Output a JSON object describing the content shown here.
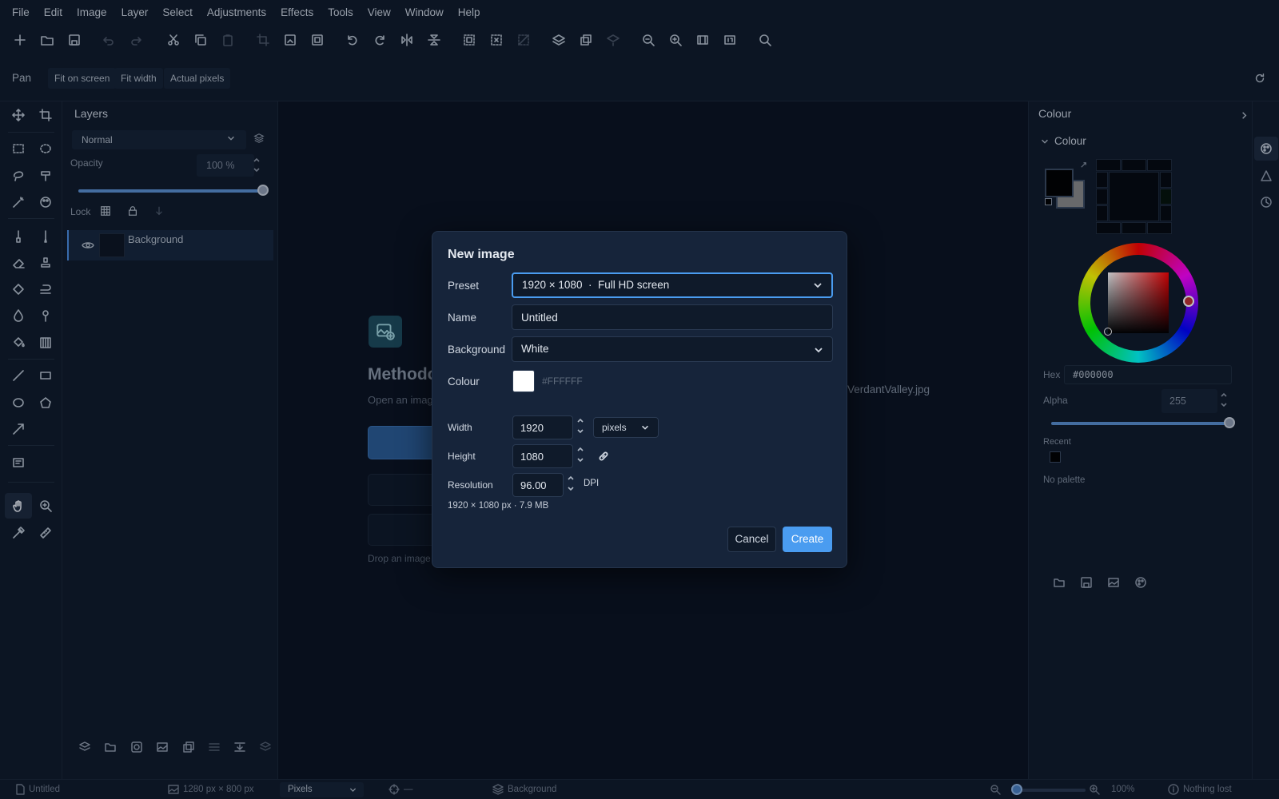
{
  "menu": [
    "File",
    "Edit",
    "Image",
    "Layer",
    "Select",
    "Adjustments",
    "Effects",
    "Tools",
    "View",
    "Window",
    "Help"
  ],
  "options_bar": {
    "tool_name": "Pan",
    "fit_on_screen": "Fit on screen",
    "fit_width": "Fit width",
    "actual_pixels": "Actual pixels"
  },
  "layers": {
    "title": "Layers",
    "blend_mode": "Normal",
    "opacity_label": "Opacity",
    "opacity_value": "100 %",
    "opacity_level": 1.0,
    "lock_label": "Lock",
    "items": [
      {
        "name": "Background"
      }
    ]
  },
  "welcome": {
    "title": "Methodo",
    "subtitle": "Open an imag",
    "drop_hint": "Drop an image a",
    "recent_file": "VerdantValley.jpg"
  },
  "colour_panel": {
    "title": "Colour",
    "section": "Colour",
    "hex_label": "Hex",
    "hex_value": "#000000",
    "alpha_label": "Alpha",
    "alpha_value": "255",
    "recent_label": "Recent",
    "palette_text": "No palette",
    "foreground": "#000000",
    "background": "#8a8a8a"
  },
  "statusbar": {
    "doc_name": "Untitled",
    "canvas_size": "1280 px × 800 px",
    "units": "Pixels",
    "cursor_pos": "—",
    "active_layer": "Background",
    "zoom": "100%",
    "history": "Nothing lost"
  },
  "dialog": {
    "title": "New image",
    "preset_label": "Preset",
    "preset_value": "1920 × 1080  ·  Full HD screen",
    "name_label": "Name",
    "name_value": "Untitled",
    "background_label": "Background",
    "background_value": "White",
    "colour_label": "Colour",
    "colour_hex": "#FFFFFF",
    "width_label": "Width",
    "width_value": "1920",
    "units_value": "pixels",
    "height_label": "Height",
    "height_value": "1080",
    "resolution_label": "Resolution",
    "resolution_value": "96.00",
    "resolution_unit": "DPI",
    "summary": "1920 × 1080 px · 7.9 MB",
    "cancel": "Cancel",
    "create": "Create"
  },
  "colors": {
    "accent": "#4a9cf0",
    "panel_bg": "#0f1a2a",
    "canvas_bg": "#0a1220",
    "dialog_bg": "#16243a"
  }
}
